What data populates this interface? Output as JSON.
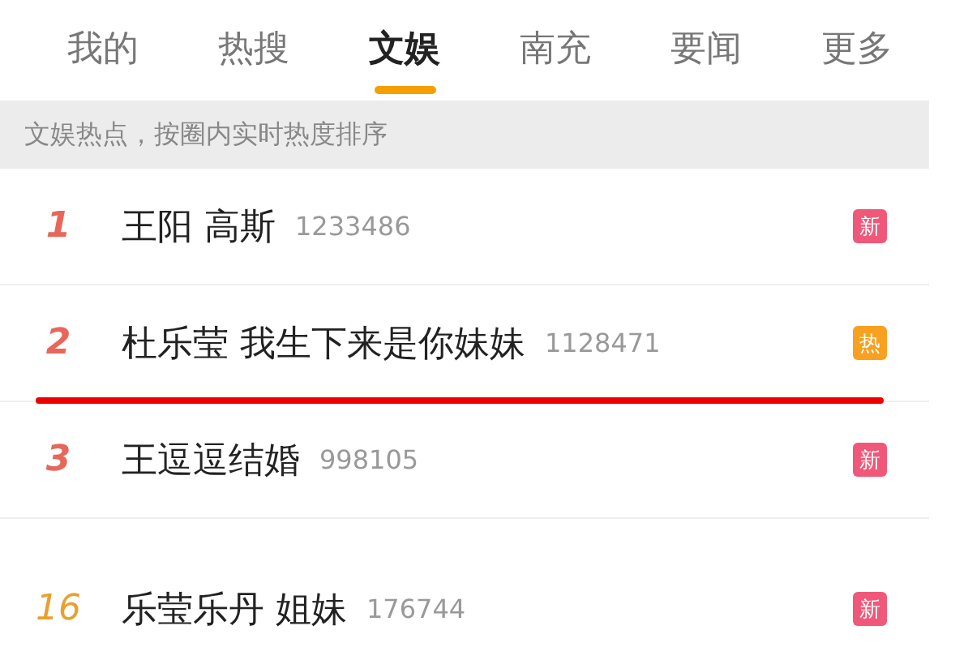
{
  "tabs": [
    {
      "label": "我的",
      "selected": false
    },
    {
      "label": "热搜",
      "selected": false
    },
    {
      "label": "文娱",
      "selected": true
    },
    {
      "label": "南充",
      "selected": false
    },
    {
      "label": "要闻",
      "selected": false
    },
    {
      "label": "更多",
      "selected": false
    }
  ],
  "banner": "文娱热点，按圈内实时热度排序",
  "rows": [
    {
      "rank": {
        "text": "1",
        "color": "#e8675a"
      },
      "title": "王阳 高斯",
      "count": "1233486",
      "badge": {
        "text": "新",
        "color": "#f0587a"
      },
      "underlined": false,
      "gap_before": false
    },
    {
      "rank": {
        "text": "2",
        "color": "#e8675a"
      },
      "title": "杜乐莹 我生下来是你妹妹",
      "count": "1128471",
      "badge": {
        "text": "热",
        "color": "#f8a020"
      },
      "underlined": true,
      "gap_before": false
    },
    {
      "rank": {
        "text": "3",
        "color": "#e8675a"
      },
      "title": "王逗逗结婚",
      "count": "998105",
      "badge": {
        "text": "新",
        "color": "#f0587a"
      },
      "underlined": false,
      "gap_before": false
    },
    {
      "rank": {
        "text": "16",
        "color": "#e8a030"
      },
      "title": "乐莹乐丹 姐妹",
      "count": "176744",
      "badge": {
        "text": "新",
        "color": "#f0587a"
      },
      "underlined": false,
      "gap_before": true
    }
  ]
}
